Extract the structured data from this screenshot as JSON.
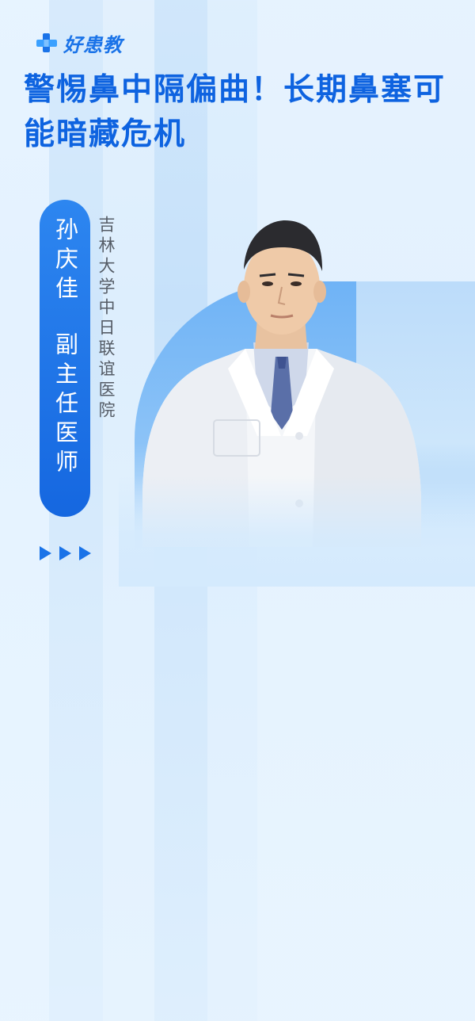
{
  "brand": {
    "name": "好患教",
    "accent": "#1a73e8"
  },
  "title": "警惕鼻中隔偏曲！长期鼻塞可能暗藏危机",
  "doctor": {
    "name": "孙庆佳",
    "position": "副主任医师",
    "hospital": "吉林大学中日联谊医院"
  },
  "decor": {
    "arrows_icon": "triple-play-arrows-icon"
  }
}
